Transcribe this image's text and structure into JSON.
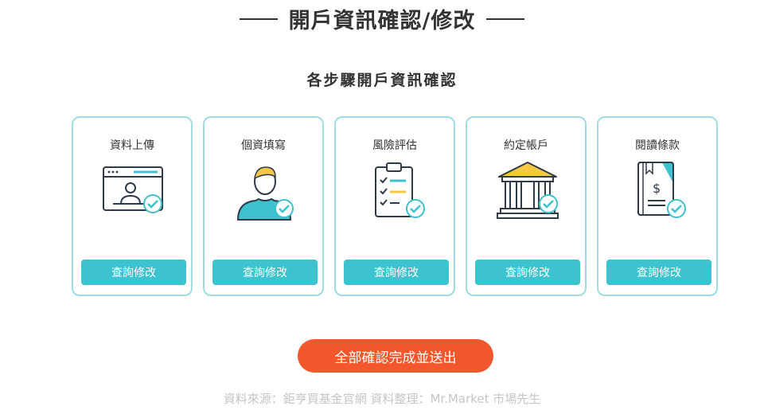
{
  "header": {
    "title": "開戶資訊確認/修改",
    "subtitle": "各步驟開戶資訊確認"
  },
  "steps": [
    {
      "label": "資料上傳",
      "icon": "upload-document-icon",
      "button_label": "查詢修改"
    },
    {
      "label": "個資填寫",
      "icon": "user-profile-icon",
      "button_label": "查詢修改"
    },
    {
      "label": "風險評估",
      "icon": "clipboard-checklist-icon",
      "button_label": "查詢修改"
    },
    {
      "label": "約定帳戶",
      "icon": "bank-building-icon",
      "button_label": "查詢修改"
    },
    {
      "label": "閱讀條款",
      "icon": "terms-book-icon",
      "button_label": "查詢修改"
    }
  ],
  "submit": {
    "label": "全部確認完成並送出"
  },
  "footer": {
    "source": "資料來源：鉅亨買基金官網   資料整理：Mr.Market 市場先生"
  },
  "colors": {
    "accent": "#3cc3cf",
    "card_border": "#9fdde3",
    "submit": "#f2582c",
    "text": "#333333",
    "icon_stroke": "#2f3b4a",
    "icon_yellow": "#f5c842",
    "footer_text": "#c6c6c6"
  }
}
